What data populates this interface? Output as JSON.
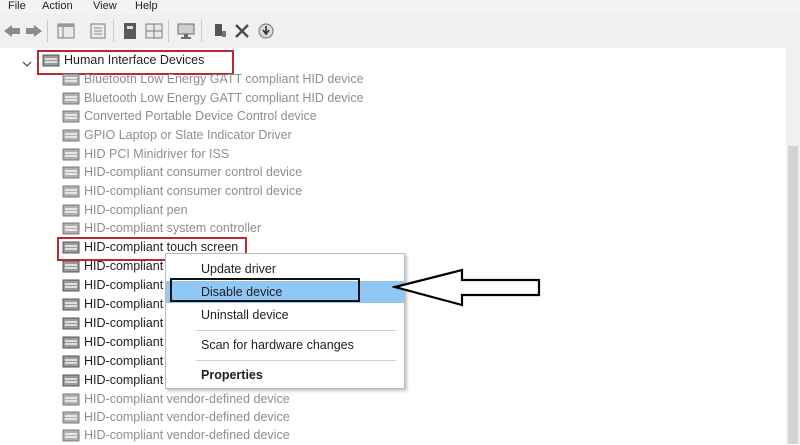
{
  "menubar": {
    "items": [
      {
        "label": "File"
      },
      {
        "label": "Action"
      },
      {
        "label": "View"
      },
      {
        "label": "Help"
      }
    ]
  },
  "toolbar": {
    "icons": [
      "back-arrow-icon",
      "forward-arrow-icon",
      "console-tree-icon",
      "properties-sheet-icon",
      "help-book-icon",
      "grid-view-icon",
      "monitor-icon",
      "update-driver-icon",
      "uninstall-x-icon",
      "download-circle-icon"
    ]
  },
  "tree": {
    "category": {
      "label": "Human Interface Devices",
      "expanded": true
    },
    "devices": [
      {
        "label": "Bluetooth Low Energy GATT compliant HID device"
      },
      {
        "label": "Bluetooth Low Energy GATT compliant HID device"
      },
      {
        "label": "Converted Portable Device Control device"
      },
      {
        "label": "GPIO Laptop or Slate Indicator Driver"
      },
      {
        "label": "HID PCI Minidriver for ISS"
      },
      {
        "label": "HID-compliant consumer control device"
      },
      {
        "label": "HID-compliant consumer control device"
      },
      {
        "label": "HID-compliant pen"
      },
      {
        "label": "HID-compliant system controller"
      },
      {
        "label": "HID-compliant touch screen"
      },
      {
        "label": "HID-compliant"
      },
      {
        "label": "HID-compliant"
      },
      {
        "label": "HID-compliant"
      },
      {
        "label": "HID-compliant"
      },
      {
        "label": "HID-compliant"
      },
      {
        "label": "HID-compliant"
      },
      {
        "label": "HID-compliant"
      },
      {
        "label": "HID-compliant vendor-defined device"
      },
      {
        "label": "HID-compliant vendor-defined device"
      },
      {
        "label": "HID-compliant vendor-defined device"
      }
    ]
  },
  "context_menu": {
    "items": [
      {
        "label": "Update driver"
      },
      {
        "label": "Disable device",
        "selected": true
      },
      {
        "label": "Uninstall device"
      },
      {
        "label": "Scan for hardware changes"
      },
      {
        "label": "Properties"
      }
    ]
  },
  "colors": {
    "highlight_border": "#c0262f",
    "selection": "#90c7f5",
    "faded_text": "#8e8e8e"
  }
}
